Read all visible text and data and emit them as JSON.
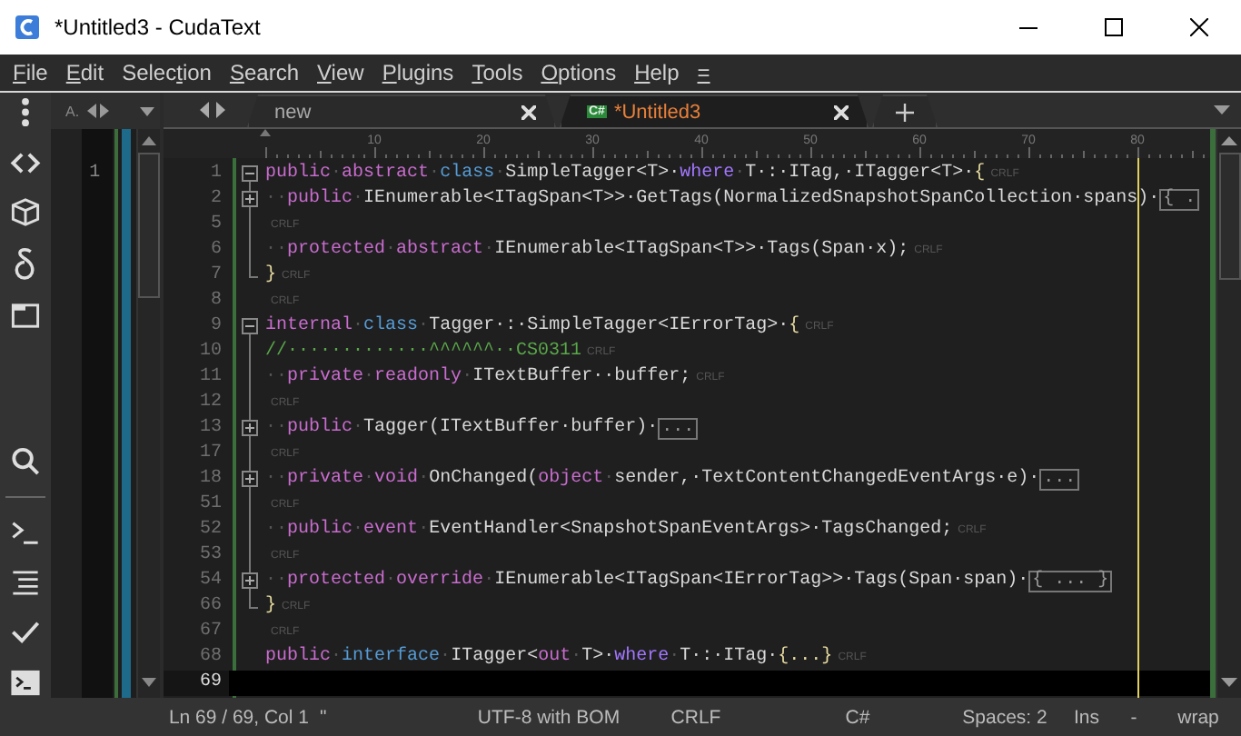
{
  "window": {
    "title": "*Untitled3 - CudaText"
  },
  "menu": [
    {
      "accel": "F",
      "rest": "ile"
    },
    {
      "accel": "E",
      "rest": "dit"
    },
    {
      "start": "Selec",
      "accel": "t",
      "rest": "ion"
    },
    {
      "accel": "S",
      "rest": "earch"
    },
    {
      "accel": "V",
      "rest": "iew"
    },
    {
      "accel": "P",
      "rest": "lugins"
    },
    {
      "accel": "T",
      "rest": "ools"
    },
    {
      "accel": "O",
      "rest": "ptions"
    },
    {
      "accel": "H",
      "rest": "elp"
    },
    {
      "accel": "="
    }
  ],
  "left_group": {
    "tab_title": "A.",
    "line_numbers": [
      "1"
    ]
  },
  "tabs": [
    {
      "title": "new",
      "selected": false
    },
    {
      "title": "*Untitled3",
      "lexer": "C#",
      "selected": true
    }
  ],
  "ruler": {
    "labels": [
      "10",
      "20",
      "30",
      "40",
      "50",
      "60",
      "70",
      "80"
    ]
  },
  "editor": {
    "lines": [
      {
        "number": "1",
        "kind": "opener",
        "current": false,
        "eol": "CRLF",
        "tokens": [
          {
            "kind": "kw",
            "text": "public"
          },
          {
            "kind": "ws",
            "text": "·"
          },
          {
            "kind": "kw",
            "text": "abstract"
          },
          {
            "kind": "ws",
            "text": "·"
          },
          {
            "kind": "type",
            "text": "class"
          },
          {
            "kind": "ws",
            "text": "·"
          },
          {
            "kind": "text",
            "text": "SimpleTagger<T>·"
          },
          {
            "kind": "ctl",
            "text": "where"
          },
          {
            "kind": "ws",
            "text": "·"
          },
          {
            "kind": "text",
            "text": "T·:·ITag,·ITagger<T>·"
          },
          {
            "kind": "brace",
            "text": "{"
          }
        ]
      },
      {
        "number": "2",
        "kind": "folded",
        "current": false,
        "fold_box": "{ .",
        "tokens": [
          {
            "kind": "ws",
            "text": "··"
          },
          {
            "kind": "kw",
            "text": "public"
          },
          {
            "kind": "ws",
            "text": "·"
          },
          {
            "kind": "text",
            "text": "IEnumerable<ITagSpan<T>>·GetTags(NormalizedSnapshotSpanCollection·spans)·"
          }
        ]
      },
      {
        "number": "5",
        "kind": "inside",
        "current": false,
        "eol": "CRLF"
      },
      {
        "number": "6",
        "kind": "inside",
        "current": false,
        "eol": "CRLF",
        "tokens": [
          {
            "kind": "ws",
            "text": "··"
          },
          {
            "kind": "kw",
            "text": "protected"
          },
          {
            "kind": "ws",
            "text": "·"
          },
          {
            "kind": "kw",
            "text": "abstract"
          },
          {
            "kind": "ws",
            "text": "·"
          },
          {
            "kind": "text",
            "text": "IEnumerable<ITagSpan<T>>·Tags(Span·x);"
          }
        ]
      },
      {
        "number": "7",
        "kind": "closer",
        "current": false,
        "eol": "CRLF",
        "tokens": [
          {
            "kind": "brace",
            "text": "}"
          }
        ]
      },
      {
        "number": "8",
        "kind": "plain",
        "current": false,
        "eol": "CRLF"
      },
      {
        "number": "9",
        "kind": "opener",
        "current": false,
        "eol": "CRLF",
        "tokens": [
          {
            "kind": "kw",
            "text": "internal"
          },
          {
            "kind": "ws",
            "text": "·"
          },
          {
            "kind": "type",
            "text": "class"
          },
          {
            "kind": "ws",
            "text": "·"
          },
          {
            "kind": "text",
            "text": "Tagger·:·SimpleTagger<IErrorTag>·"
          },
          {
            "kind": "brace",
            "text": "{"
          }
        ]
      },
      {
        "number": "10",
        "kind": "inside",
        "current": false,
        "eol": "CRLF",
        "tokens": [
          {
            "kind": "comment",
            "text": "//·············^^^^^^··CS0311"
          }
        ]
      },
      {
        "number": "11",
        "kind": "inside",
        "current": false,
        "eol": "CRLF",
        "tokens": [
          {
            "kind": "ws",
            "text": "··"
          },
          {
            "kind": "kw",
            "text": "private"
          },
          {
            "kind": "ws",
            "text": "·"
          },
          {
            "kind": "kw",
            "text": "readonly"
          },
          {
            "kind": "ws",
            "text": "·"
          },
          {
            "kind": "text",
            "text": "ITextBuffer··buffer;"
          }
        ]
      },
      {
        "number": "12",
        "kind": "inside",
        "current": false,
        "eol": "CRLF"
      },
      {
        "number": "13",
        "kind": "folded",
        "current": false,
        "fold_box": "...",
        "tokens": [
          {
            "kind": "ws",
            "text": "··"
          },
          {
            "kind": "kw",
            "text": "public"
          },
          {
            "kind": "ws",
            "text": "·"
          },
          {
            "kind": "text",
            "text": "Tagger(ITextBuffer·buffer)·"
          }
        ]
      },
      {
        "number": "17",
        "kind": "inside",
        "current": false,
        "eol": "CRLF"
      },
      {
        "number": "18",
        "kind": "folded",
        "current": false,
        "fold_box": "...",
        "tokens": [
          {
            "kind": "ws",
            "text": "··"
          },
          {
            "kind": "kw",
            "text": "private"
          },
          {
            "kind": "ws",
            "text": "·"
          },
          {
            "kind": "kw",
            "text": "void"
          },
          {
            "kind": "ws",
            "text": "·"
          },
          {
            "kind": "text",
            "text": "OnChanged("
          },
          {
            "kind": "kw",
            "text": "object"
          },
          {
            "kind": "ws",
            "text": "·"
          },
          {
            "kind": "text",
            "text": "sender,·TextContentChangedEventArgs·e)·"
          }
        ]
      },
      {
        "number": "51",
        "kind": "inside",
        "current": false,
        "eol": "CRLF"
      },
      {
        "number": "52",
        "kind": "inside",
        "current": false,
        "eol": "CRLF",
        "tokens": [
          {
            "kind": "ws",
            "text": "··"
          },
          {
            "kind": "kw",
            "text": "public"
          },
          {
            "kind": "ws",
            "text": "·"
          },
          {
            "kind": "kw",
            "text": "event"
          },
          {
            "kind": "ws",
            "text": "·"
          },
          {
            "kind": "text",
            "text": "EventHandler<SnapshotSpanEventArgs>·TagsChanged;"
          }
        ]
      },
      {
        "number": "53",
        "kind": "inside",
        "current": false,
        "eol": "CRLF"
      },
      {
        "number": "54",
        "kind": "folded",
        "current": false,
        "fold_box": "{ ... }",
        "tokens": [
          {
            "kind": "ws",
            "text": "··"
          },
          {
            "kind": "kw",
            "text": "protected"
          },
          {
            "kind": "ws",
            "text": "·"
          },
          {
            "kind": "kw",
            "text": "override"
          },
          {
            "kind": "ws",
            "text": "·"
          },
          {
            "kind": "text",
            "text": "IEnumerable<ITagSpan<IErrorTag>>·Tags(Span·span)·"
          }
        ]
      },
      {
        "number": "66",
        "kind": "closer",
        "current": false,
        "eol": "CRLF",
        "tokens": [
          {
            "kind": "brace",
            "text": "}"
          }
        ]
      },
      {
        "number": "67",
        "kind": "plain",
        "current": false,
        "eol": "CRLF"
      },
      {
        "number": "68",
        "kind": "plain",
        "current": false,
        "eol": "CRLF",
        "tokens": [
          {
            "kind": "kw",
            "text": "public"
          },
          {
            "kind": "ws",
            "text": "·"
          },
          {
            "kind": "type",
            "text": "interface"
          },
          {
            "kind": "ws",
            "text": "·"
          },
          {
            "kind": "text",
            "text": "ITagger<"
          },
          {
            "kind": "kw",
            "text": "out"
          },
          {
            "kind": "ws",
            "text": "·"
          },
          {
            "kind": "text",
            "text": "T>·"
          },
          {
            "kind": "ctl",
            "text": "where"
          },
          {
            "kind": "ws",
            "text": "·"
          },
          {
            "kind": "text",
            "text": "T·:·ITag·"
          },
          {
            "kind": "brace",
            "text": "{...}"
          }
        ]
      },
      {
        "number": "69",
        "kind": "plain",
        "current": true
      }
    ]
  },
  "status_bar": {
    "items": [
      "Ln 69 / 69, Col 1",
      "\"",
      "UTF-8 with BOM",
      "CRLF",
      "C#",
      "Spaces: 2",
      "Ins",
      "-",
      "wrap"
    ]
  }
}
